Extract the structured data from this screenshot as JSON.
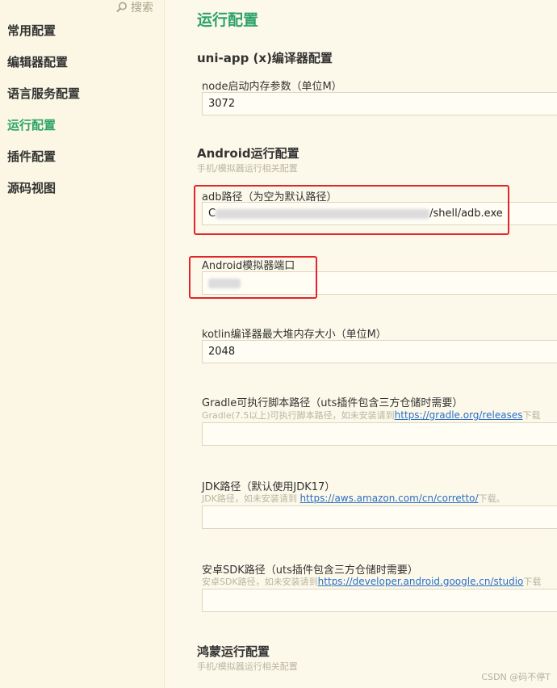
{
  "sidebar": {
    "search_label": "搜索",
    "items": [
      {
        "label": "常用配置",
        "active": false
      },
      {
        "label": "编辑器配置",
        "active": false
      },
      {
        "label": "语言服务配置",
        "active": false
      },
      {
        "label": "运行配置",
        "active": true
      },
      {
        "label": "插件配置",
        "active": false
      },
      {
        "label": "源码视图",
        "active": false
      }
    ]
  },
  "main": {
    "title": "运行配置",
    "uniapp": {
      "section_title": "uni-app (x)编译器配置",
      "node_memory_label": "node启动内存参数（单位M）",
      "node_memory_value": "3072"
    },
    "android": {
      "section_title": "Android运行配置",
      "section_sub": "手机/模拟器运行相关配置",
      "adb_label": "adb路径（为空为默认路径）",
      "adb_value_prefix": "C",
      "adb_value_suffix": "/shell/adb.exe",
      "emulator_port_label": "Android模拟器端口",
      "kotlin_label": "kotlin编译器最大堆内存大小（单位M）",
      "kotlin_value": "2048",
      "gradle_label": "Gradle可执行脚本路径（uts插件包含三方仓储时需要）",
      "gradle_hint_prefix": "Gradle(7.5以上)可执行脚本路径，如未安装请到",
      "gradle_hint_link": "https://gradle.org/releases",
      "gradle_hint_suffix": "下载",
      "jdk_label": "JDK路径（默认使用JDK17）",
      "jdk_hint_prefix": "JDK路径，如未安装请到 ",
      "jdk_hint_link": "https://aws.amazon.com/cn/corretto/",
      "jdk_hint_suffix": "下载。",
      "sdk_label": "安卓SDK路径（uts插件包含三方仓储时需要）",
      "sdk_hint_prefix": "安卓SDK路径，如未安装请到",
      "sdk_hint_link": "https://developer.android.google.cn/studio",
      "sdk_hint_suffix": "下载"
    },
    "harmony": {
      "section_title": "鸿蒙运行配置",
      "section_sub": "手机/模拟器运行相关配置"
    }
  },
  "watermark": "CSDN @码不停T",
  "colors": {
    "accent": "#2fa36b",
    "highlight_box": "#e2242b",
    "link": "#2a6fc9"
  }
}
